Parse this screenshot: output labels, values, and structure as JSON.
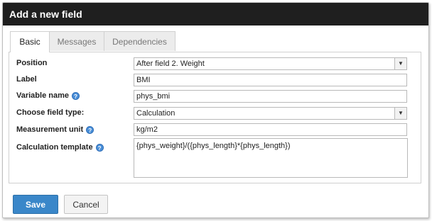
{
  "dialog": {
    "title": "Add a new field"
  },
  "tabs": [
    {
      "label": "Basic"
    },
    {
      "label": "Messages"
    },
    {
      "label": "Dependencies"
    }
  ],
  "form": {
    "position_label": "Position",
    "position_value": "After field 2. Weight",
    "label_label": "Label",
    "label_value": "BMI",
    "variable_label": "Variable name",
    "variable_value": "phys_bmi",
    "type_label": "Choose field type:",
    "type_value": "Calculation",
    "unit_label": "Measurement unit",
    "unit_value": "kg/m2",
    "template_label": "Calculation template",
    "template_value": "{phys_weight}/({phys_length}*{phys_length})"
  },
  "buttons": {
    "save": "Save",
    "cancel": "Cancel"
  },
  "colors": {
    "titlebar": "#1f1f1f",
    "save_button": "#3a87c9",
    "help_icon": "#4a8fd8"
  },
  "icons": {
    "help": "question-mark-circle",
    "dropdown": "chevron-down"
  }
}
